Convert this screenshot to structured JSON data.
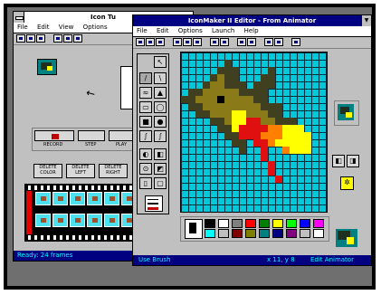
{
  "back_window": {
    "title": "Icon Tu",
    "menu": [
      "File",
      "Edit",
      "View",
      "Options"
    ],
    "buttons": {
      "record": "RECORD",
      "step": "STEP",
      "play": "PLAY",
      "delete_color": "DELETE\nCOLOR",
      "delete_left": "DELETE\nLEFT",
      "delete_right": "DELETE\nRIGHT"
    },
    "status": "Ready: 24 frames"
  },
  "front_window": {
    "title": "IconMaker II Editor - From Animator",
    "menu": [
      "File",
      "Edit",
      "Options",
      "Launch",
      "Help"
    ],
    "status_left": "Use Brush",
    "status_mid": "x 11, y 8",
    "status_right": "Edit Animator"
  },
  "colors": {
    "title_active": "#000080",
    "canvas": "#00c8d8",
    "dragon_dark": "#404020",
    "dragon_olive": "#8a7a18",
    "flame_yellow": "#ffff00",
    "flame_red": "#e01010",
    "flame_orange": "#ff8000"
  },
  "palette": [
    "#000000",
    "#ffffff",
    "#808080",
    "#ff0000",
    "#008000",
    "#ffff00",
    "#00ff00",
    "#0000ff",
    "#ff00ff",
    "#00ffff",
    "#c0c0c0",
    "#800000",
    "#808000",
    "#008080",
    "#000080",
    "#800080",
    "#c0c0c0",
    "#ffffff"
  ],
  "tools": [
    "arrow-icon",
    "pencil-icon",
    "line-icon",
    "brush-icon",
    "fill-icon",
    "rect-icon",
    "ellipse-icon",
    "spray-icon",
    "text-icon",
    "zoom-icon",
    "eraser-icon",
    "picker-icon",
    "flip-icon",
    "rotate-icon"
  ]
}
